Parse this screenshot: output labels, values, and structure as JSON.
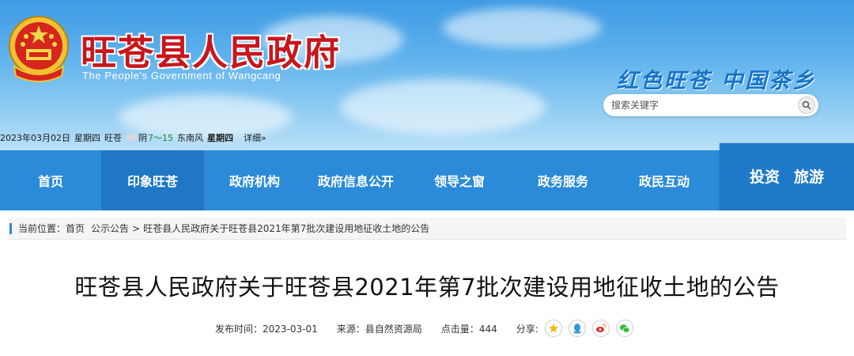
{
  "header": {
    "title": "旺苍县人民政府",
    "subtitle": "The People's Government of Wangcang",
    "slogan": "红色旺苍 中国茶乡",
    "emblem_icon": "national-emblem-icon",
    "colors": {
      "title_red": "#c8161d",
      "sky_blue": "#3f9be4",
      "slogan_blue": "#1673c8"
    }
  },
  "search": {
    "placeholder": "搜索关键字",
    "icon": "search-icon"
  },
  "infobar": {
    "date": "2023年03月02日",
    "weekday": "星期四",
    "city": "旺苍",
    "weather": "阴",
    "temp": "7～15",
    "wind": "东南风",
    "weekday2": "星期四",
    "detail_link": "详细»",
    "weather_icon": "cloud-icon"
  },
  "nav": {
    "items": [
      {
        "label": "首页"
      },
      {
        "label": "印象旺苍",
        "active": true
      },
      {
        "label": "政府机构"
      },
      {
        "label": "政府信息公开"
      },
      {
        "label": "领导之窗"
      },
      {
        "label": "政务服务"
      },
      {
        "label": "政民互动"
      }
    ],
    "special": [
      "投资",
      "旅游"
    ],
    "colors": {
      "bar": "#2b8bd9",
      "active": "#1f77c6"
    }
  },
  "breadcrumb": {
    "prefix": "当前位置：",
    "home": "首页",
    "section": "公示公告",
    "separator": ">",
    "current": "旺苍县人民政府关于旺苍县2021年第7批次建设用地征收土地的公告"
  },
  "article": {
    "title": "旺苍县人民政府关于旺苍县2021年第7批次建设用地征收土地的公告",
    "publish_label": "发布时间：",
    "publish_date": "2023-03-01",
    "source_label": "来源：",
    "source": "县自然资源局",
    "hits_label": "点击量：",
    "hits": "444",
    "share_label": "分享:",
    "share_icons": [
      "qzone-icon",
      "qq-icon",
      "weibo-icon",
      "wechat-icon"
    ]
  }
}
